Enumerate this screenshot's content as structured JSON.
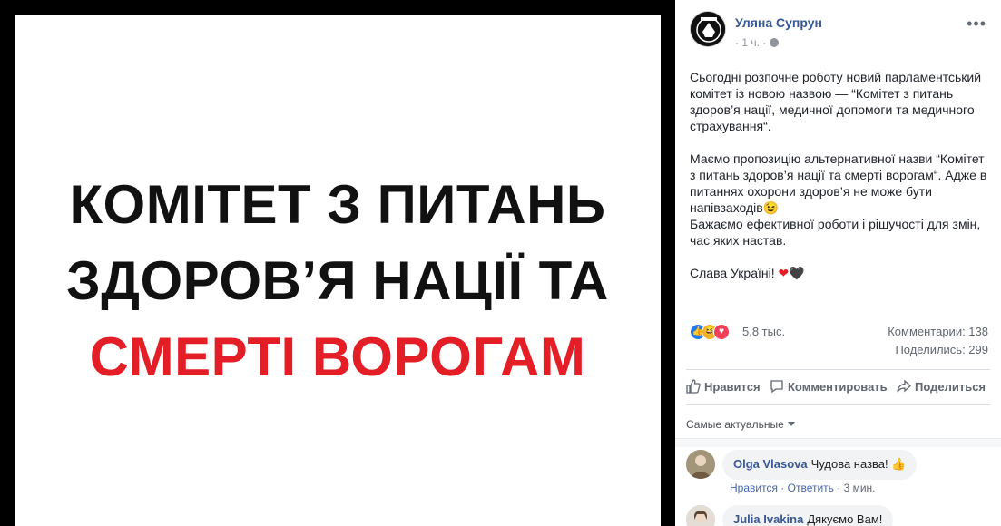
{
  "image": {
    "headline_line1": "КОМІТЕТ З ПИТАНЬ",
    "headline_line2": "ЗДОРОВ’Я НАЦІЇ ТА",
    "headline_line3": "СМЕРТІ ВОРОГАМ",
    "accent_color": "#e41e26"
  },
  "post": {
    "author": "Уляна Супрун",
    "time": "· 1 ч. ·",
    "more_icon": "ellipsis-icon",
    "paragraphs": [
      "Сьогодні розпочне роботу новий парламентський комітет із новою назвою — “Комітет з питань здоров’я нації, медичної допомоги та медичного страхування“.",
      "Маємо пропозицію альтернативної назви “Комітет з питань здоров’я нації та смерті ворогам“. Адже в питаннях охорони здоров’я не може бути напівзаходів😉",
      "Бажаємо ефективної роботи і рішучості для змін, час яких настав.",
      "Слава Україні!"
    ],
    "hearts": [
      "❤",
      "🖤"
    ]
  },
  "stats": {
    "reactions_count": "5,8 тыс.",
    "comments": "Комментарии: 138",
    "shares": "Поделились: 299"
  },
  "actions": {
    "like": "Нравится",
    "comment": "Комментировать",
    "share": "Поделиться"
  },
  "sort": {
    "label": "Самые актуальные"
  },
  "comments": [
    {
      "author": "Olga Vlasova",
      "text": "Чудова назва! 👍",
      "like": "Нравится",
      "reply": "Ответить",
      "time": "3 мин."
    },
    {
      "author": "Julia Ivakina",
      "text": "Дякуємо Вам!"
    }
  ]
}
